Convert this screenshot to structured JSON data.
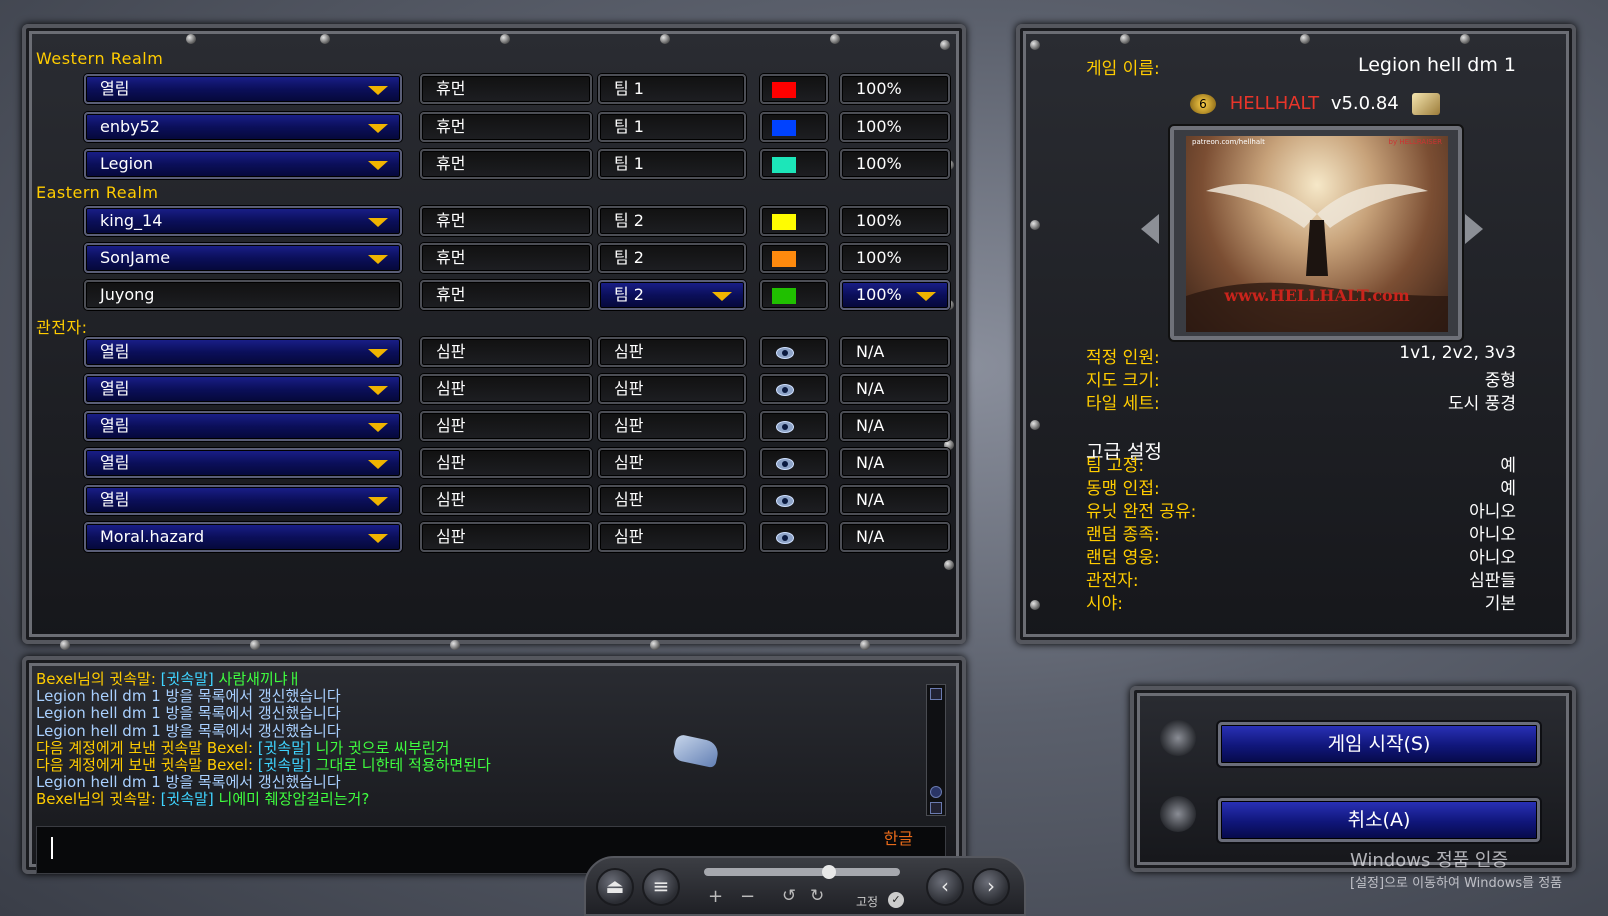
{
  "groups": {
    "western": "Western Realm",
    "eastern": "Eastern Realm",
    "observers": "관전자:"
  },
  "players": [
    {
      "name": "열림",
      "race": "휴먼",
      "team": "팀 1",
      "color": "#ff0000",
      "handicap": "100%",
      "nameDropdown": true
    },
    {
      "name": "enby52",
      "race": "휴먼",
      "team": "팀 1",
      "color": "#0042ff",
      "handicap": "100%",
      "nameDropdown": true
    },
    {
      "name": "Legion",
      "race": "휴먼",
      "team": "팀 1",
      "color": "#1ce6b9",
      "handicap": "100%",
      "nameDropdown": true
    },
    {
      "name": "king_14",
      "race": "휴먼",
      "team": "팀 2",
      "color": "#fffc01",
      "handicap": "100%",
      "nameDropdown": true
    },
    {
      "name": "SonJame",
      "race": "휴먼",
      "team": "팀 2",
      "color": "#fe8a0e",
      "handicap": "100%",
      "nameDropdown": true
    },
    {
      "name": "Juyong",
      "race": "휴먼",
      "team": "팀 2",
      "color": "#20c000",
      "handicap": "100%",
      "nameDropdown": false
    }
  ],
  "observers": [
    {
      "name": "열림",
      "race": "심판",
      "team": "심판",
      "handicap": "N/A"
    },
    {
      "name": "열림",
      "race": "심판",
      "team": "심판",
      "handicap": "N/A"
    },
    {
      "name": "열림",
      "race": "심판",
      "team": "심판",
      "handicap": "N/A"
    },
    {
      "name": "열림",
      "race": "심판",
      "team": "심판",
      "handicap": "N/A"
    },
    {
      "name": "열림",
      "race": "심판",
      "team": "심판",
      "handicap": "N/A"
    },
    {
      "name": "Moral.hazard",
      "race": "심판",
      "team": "심판",
      "handicap": "N/A"
    }
  ],
  "gameInfo": {
    "nameLabel": "게임 이름:",
    "nameValue": "Legion hell dm 1",
    "mapTitle": "HELLHALT",
    "mapVersion": "v5.0.84",
    "previewTopLeft": "patreon.com/hellhalt",
    "previewTopRight": "by HELLRAISER",
    "previewWatermark": "www.HELLHALT.com",
    "details": [
      {
        "label": "적정 인원:",
        "value": "1v1, 2v2, 3v3"
      },
      {
        "label": "지도 크기:",
        "value": "중형"
      },
      {
        "label": "타일 세트:",
        "value": "도시 풍경"
      }
    ],
    "advancedTitle": "고급 설정",
    "advanced": [
      {
        "label": "팀 고정:",
        "value": "예"
      },
      {
        "label": "동맹 인접:",
        "value": "예"
      },
      {
        "label": "유닛 완전 공유:",
        "value": "아니오"
      },
      {
        "label": "랜덤 종족:",
        "value": "아니오"
      },
      {
        "label": "랜덤 영웅:",
        "value": "아니오"
      },
      {
        "label": "관전자:",
        "value": "심판들"
      },
      {
        "label": "시야:",
        "value": "기본"
      }
    ]
  },
  "chat": [
    {
      "parts": [
        {
          "t": "Bexel님의 귓속말: ",
          "c": "gold"
        },
        {
          "t": "[귓속말] ",
          "c": "cyan"
        },
        {
          "t": "사람새끼냐ㅐ",
          "c": "green"
        }
      ]
    },
    {
      "parts": [
        {
          "t": "Legion hell dm 1 방을 목록에서 갱신했습니다",
          "c": "lightblue"
        }
      ]
    },
    {
      "parts": [
        {
          "t": "Legion hell dm 1 방을 목록에서 갱신했습니다",
          "c": "lightblue"
        }
      ]
    },
    {
      "parts": [
        {
          "t": "Legion hell dm 1 방을 목록에서 갱신했습니다",
          "c": "lightblue"
        }
      ]
    },
    {
      "parts": [
        {
          "t": "다음 계정에게 보낸 귓속말 Bexel: ",
          "c": "gold"
        },
        {
          "t": "[귓속말] ",
          "c": "cyan"
        },
        {
          "t": "니가 귓으로 씨부린거",
          "c": "green"
        }
      ]
    },
    {
      "parts": [
        {
          "t": "다음 계정에게 보낸 귓속말 Bexel: ",
          "c": "gold"
        },
        {
          "t": "[귓속말] ",
          "c": "cyan"
        },
        {
          "t": "그대로 니한테 적용하면된다",
          "c": "green"
        }
      ]
    },
    {
      "parts": [
        {
          "t": "Legion hell dm 1 방을 목록에서 갱신했습니다",
          "c": "lightblue"
        }
      ]
    },
    {
      "parts": [
        {
          "t": "Bexel님의 귓속말: ",
          "c": "gold"
        },
        {
          "t": "[귓속말] ",
          "c": "cyan"
        },
        {
          "t": "니에미 췌장암걸리는거?",
          "c": "green"
        }
      ]
    }
  ],
  "chatInput": {
    "ime": "한글"
  },
  "buttons": {
    "start": "게임 시작(S)",
    "cancel": "취소(A)"
  },
  "toolbar": {
    "lock": "고정"
  },
  "watermark": {
    "line1": "Windows 정품 인증",
    "line2": "[설정]으로 이동하여 Windows를 정품"
  }
}
